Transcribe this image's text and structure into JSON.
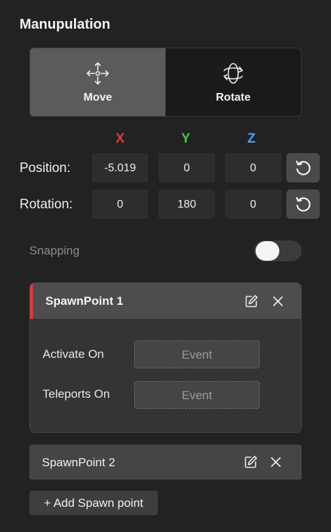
{
  "header": {
    "title": "Manupulation"
  },
  "mode": {
    "move_label": "Move",
    "rotate_label": "Rotate",
    "active": "Move"
  },
  "axes": {
    "x": {
      "label": "X",
      "color": "#e53935"
    },
    "y": {
      "label": "Y",
      "color": "#3ecf3e"
    },
    "z": {
      "label": "Z",
      "color": "#42a5f5"
    }
  },
  "transform": {
    "position": {
      "label": "Position:",
      "x": "-5.019",
      "y": "0",
      "z": "0"
    },
    "rotation": {
      "label": "Rotation:",
      "x": "0",
      "y": "180",
      "z": "0"
    }
  },
  "snapping": {
    "label": "Snapping",
    "enabled": false
  },
  "spawn_points": [
    {
      "name": "SpawnPoint 1",
      "expanded": true,
      "accent": "#e53935",
      "activate_label": "Activate On",
      "activate_value": "Event",
      "teleport_label": "Teleports On",
      "teleport_value": "Event"
    },
    {
      "name": "SpawnPoint 2",
      "expanded": false
    }
  ],
  "add_button_label": "+ Add Spawn point",
  "icons": {
    "move": "move-arrows-icon",
    "rotate": "rotate-orbit-icon",
    "reset": "reset-icon",
    "edit": "edit-icon",
    "close": "close-icon"
  }
}
